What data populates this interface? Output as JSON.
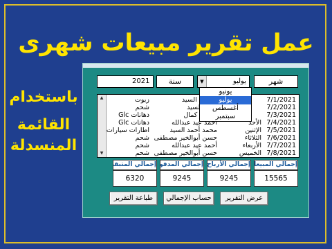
{
  "title": "عمل تقرير مبيعات شهرى",
  "side_text": {
    "line1": "باستخدام",
    "line2": "القائمة",
    "line3": "المنسدلة"
  },
  "filters": {
    "month_label": "شهر",
    "month_value": "يوليو",
    "year_label": "سنة",
    "year_value": "2021"
  },
  "month_dropdown": {
    "options": [
      "يونيو",
      "يوليو",
      "أغسطس",
      "سبتمبر"
    ],
    "selected_index": 1
  },
  "rows": [
    {
      "date": "7/1/2021",
      "day": "",
      "name": "د أحمد السيد",
      "item": "زيوت"
    },
    {
      "date": "7/2/2021",
      "day": "",
      "name": "أحمد السيد",
      "item": "شحم"
    },
    {
      "date": "7/3/2021",
      "day": "",
      "name": "منصور كمال",
      "item": "دهانات Glc"
    },
    {
      "date": "7/4/2021",
      "day": "الأحد",
      "name": "أحمد عيد عبدالله",
      "item": "دهانات Glc"
    },
    {
      "date": "7/5/2021",
      "day": "الإثنين",
      "name": "محمد أحمد السيد",
      "item": "اطارات سيارات"
    },
    {
      "date": "7/6/2021",
      "day": "الثلاثاء",
      "name": "حسن أبوالخير مصطفى",
      "item": "شحم"
    },
    {
      "date": "7/7/2021",
      "day": "الأربعاء",
      "name": "أحمد عيد عبدالله",
      "item": "شحم"
    },
    {
      "date": "7/8/2021",
      "day": "الخميس",
      "name": "حسن أبوالخير مصطفى",
      "item": "شحم"
    }
  ],
  "totals": {
    "sales_label": "إجمالي المبيعات",
    "sales_value": "15565",
    "profit_label": "إجمالي الأرباح",
    "profit_value": "9245",
    "paid_label": "إجمالي المدفوع",
    "paid_value": "9245",
    "remaining_label": "إجمالي المتبقي",
    "remaining_value": "6320"
  },
  "buttons": {
    "show_report": "عرض التقرير",
    "calc_total": "حساب الإجمالي",
    "print_report": "طباعة التقرير"
  },
  "colors": {
    "background": "#1f3f8f",
    "accent_yellow": "#ffe400",
    "form_teal": "#1c8a84",
    "border_gold": "#dcbd2a"
  }
}
